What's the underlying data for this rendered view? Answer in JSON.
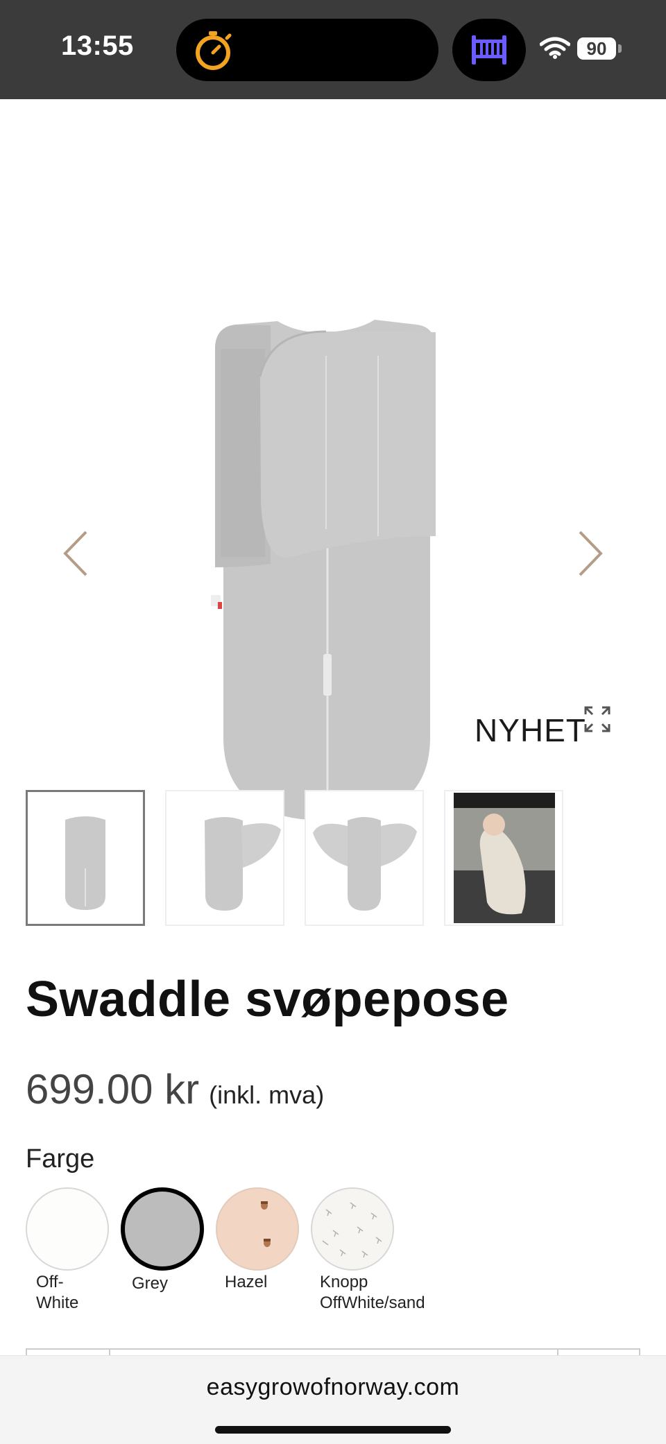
{
  "status_bar": {
    "time": "13:55",
    "timer_icon": "stopwatch-icon",
    "app_icon": "crib-icon",
    "wifi_icon": "wifi-icon",
    "battery_level": "90",
    "accent_timer": "#f2a321",
    "accent_crib": "#6a5cff"
  },
  "gallery": {
    "badge": "NYHET",
    "prev_icon": "chevron-left-icon",
    "next_icon": "chevron-right-icon",
    "expand_icon": "expand-icon",
    "thumbnails": [
      {
        "name": "thumb-front",
        "active": true
      },
      {
        "name": "thumb-one-wing-open",
        "active": false
      },
      {
        "name": "thumb-wings-open",
        "active": false
      },
      {
        "name": "thumb-baby-photo",
        "active": false
      }
    ]
  },
  "product": {
    "title": "Swaddle svøpepose",
    "price": "699.00 kr",
    "vat_note": "(inkl. mva)",
    "color_label": "Farge",
    "colors": [
      {
        "line1": "Off-",
        "line2": "White",
        "hex": "#fdfdfb",
        "selected": false
      },
      {
        "line1": "Grey",
        "line2": "",
        "hex": "#bcbcbc",
        "selected": true
      },
      {
        "line1": "Hazel",
        "line2": "",
        "hex": "#f2d6c3",
        "selected": false
      },
      {
        "line1": "Knopp",
        "line2": "OffWhite/sand",
        "hex": "#f7f5f2",
        "selected": false
      }
    ]
  },
  "browser": {
    "url": "easygrowofnorway.com"
  }
}
